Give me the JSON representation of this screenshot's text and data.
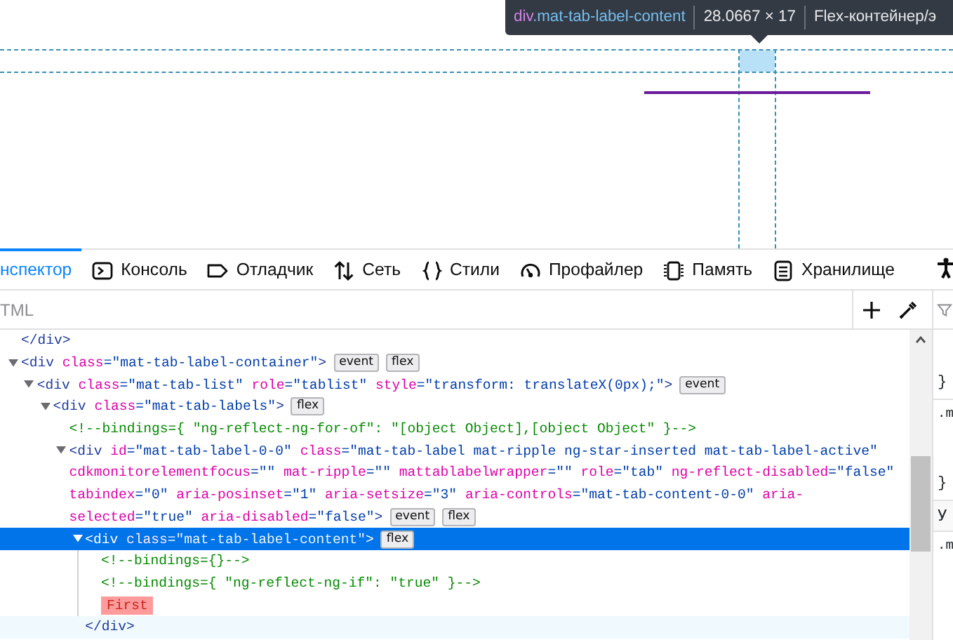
{
  "page_overlay": {
    "tooltip": {
      "tag": "div",
      "classes": ".mat-tab-label-content",
      "size": "28.0667 × 17",
      "type": "Flex-контейнер/э"
    }
  },
  "toolbar": {
    "tabs": [
      {
        "label": "нспектор",
        "selected": true
      },
      {
        "label": "Консоль",
        "selected": false
      },
      {
        "label": "Отладчик",
        "selected": false
      },
      {
        "label": "Сеть",
        "selected": false
      },
      {
        "label": "Стили",
        "selected": false
      },
      {
        "label": "Профайлер",
        "selected": false
      },
      {
        "label": "Память",
        "selected": false
      },
      {
        "label": "Хранилище",
        "selected": false
      }
    ]
  },
  "search": {
    "placeholder": "TML"
  },
  "markup_tree": [
    {
      "lines": [
        [
          {
            "kind": "tag",
            "text": "</div>"
          }
        ]
      ]
    },
    {
      "expanded": true,
      "badges": [
        "event",
        "flex"
      ],
      "lines": [
        [
          {
            "kind": "tag",
            "text": "<div"
          },
          {
            "kind": "attr",
            "text": " class"
          },
          {
            "kind": "value",
            "text": "=\"mat-tab-label-container\""
          },
          {
            "kind": "tag",
            "text": ">"
          }
        ]
      ],
      "children": [
        {
          "expanded": true,
          "badges": [
            "event"
          ],
          "lines": [
            [
              {
                "kind": "tag",
                "text": "<div"
              },
              {
                "kind": "attr",
                "text": " class"
              },
              {
                "kind": "value",
                "text": "=\"mat-tab-list\""
              },
              {
                "kind": "attr",
                "text": " role"
              },
              {
                "kind": "value",
                "text": "=\"tablist\""
              },
              {
                "kind": "attr",
                "text": " style"
              },
              {
                "kind": "value",
                "text": "=\"transform: translateX(0px);\""
              },
              {
                "kind": "tag",
                "text": ">"
              }
            ]
          ],
          "children": [
            {
              "expanded": true,
              "badges": [
                "flex"
              ],
              "lines": [
                [
                  {
                    "kind": "tag",
                    "text": "<div"
                  },
                  {
                    "kind": "attr",
                    "text": " class"
                  },
                  {
                    "kind": "value",
                    "text": "=\"mat-tab-labels\""
                  },
                  {
                    "kind": "tag",
                    "text": ">"
                  }
                ]
              ],
              "children": [
                {
                  "lines": [
                    [
                      {
                        "kind": "comment",
                        "text": "<!--bindings={ \"ng-reflect-ng-for-of\": \"[object Object],[object Object\" }-->"
                      }
                    ]
                  ]
                },
                {
                  "expanded": true,
                  "badges": [
                    "event",
                    "flex"
                  ],
                  "lines": [
                    [
                      {
                        "kind": "tag",
                        "text": "<div"
                      },
                      {
                        "kind": "attr",
                        "text": " id"
                      },
                      {
                        "kind": "value",
                        "text": "=\"mat-tab-label-0-0\""
                      },
                      {
                        "kind": "attr",
                        "text": " class"
                      },
                      {
                        "kind": "value",
                        "text": "=\"mat-tab-label mat-ripple ng-star-inserted mat-tab-label-active\""
                      }
                    ],
                    [
                      {
                        "kind": "attr",
                        "text": "cdkmonitorelementfocus"
                      },
                      {
                        "kind": "value",
                        "text": "=\"\""
                      },
                      {
                        "kind": "attr",
                        "text": " mat-ripple"
                      },
                      {
                        "kind": "value",
                        "text": "=\"\""
                      },
                      {
                        "kind": "attr",
                        "text": " mattablabelwrapper"
                      },
                      {
                        "kind": "value",
                        "text": "=\"\""
                      },
                      {
                        "kind": "attr",
                        "text": " role"
                      },
                      {
                        "kind": "value",
                        "text": "=\"tab\""
                      },
                      {
                        "kind": "attr",
                        "text": " ng-reflect-disabled"
                      },
                      {
                        "kind": "value",
                        "text": "=\"false\""
                      }
                    ],
                    [
                      {
                        "kind": "attr",
                        "text": "tabindex"
                      },
                      {
                        "kind": "value",
                        "text": "=\"0\""
                      },
                      {
                        "kind": "attr",
                        "text": " aria-posinset"
                      },
                      {
                        "kind": "value",
                        "text": "=\"1\""
                      },
                      {
                        "kind": "attr",
                        "text": " aria-setsize"
                      },
                      {
                        "kind": "value",
                        "text": "=\"3\""
                      },
                      {
                        "kind": "attr",
                        "text": " aria-controls"
                      },
                      {
                        "kind": "value",
                        "text": "=\"mat-tab-content-0-0\""
                      },
                      {
                        "kind": "attr",
                        "text": " aria-"
                      }
                    ],
                    [
                      {
                        "kind": "attr",
                        "text": "selected"
                      },
                      {
                        "kind": "value",
                        "text": "=\"true\""
                      },
                      {
                        "kind": "attr",
                        "text": " aria-disabled"
                      },
                      {
                        "kind": "value",
                        "text": "=\"false\""
                      },
                      {
                        "kind": "tag",
                        "text": ">"
                      }
                    ]
                  ],
                  "children": [
                    {
                      "expanded": true,
                      "selected": true,
                      "badges": [
                        "flex"
                      ],
                      "lines": [
                        [
                          {
                            "kind": "tag",
                            "text": "<div"
                          },
                          {
                            "kind": "attr",
                            "text": " class"
                          },
                          {
                            "kind": "value",
                            "text": "=\"mat-tab-label-content\""
                          },
                          {
                            "kind": "tag",
                            "text": ">"
                          }
                        ]
                      ],
                      "children": [
                        {
                          "lines": [
                            [
                              {
                                "kind": "comment",
                                "text": "<!--bindings={}-->"
                              }
                            ]
                          ]
                        },
                        {
                          "lines": [
                            [
                              {
                                "kind": "comment",
                                "text": "<!--bindings={ \"ng-reflect-ng-if\": \"true\" }-->"
                              }
                            ]
                          ]
                        },
                        {
                          "lines": [
                            [
                              {
                                "kind": "text",
                                "text": "First",
                                "highlighted": true
                              }
                            ]
                          ]
                        }
                      ],
                      "close": [
                        {
                          "kind": "tag",
                          "text": "</div>"
                        }
                      ]
                    }
                  ]
                }
              ]
            }
          ]
        }
      ]
    }
  ],
  "side_panel": [
    {
      "kind": "brace",
      "text": "}"
    },
    {
      "kind": "selector",
      "text": ".m"
    },
    {
      "kind": "brace",
      "text": "}"
    },
    {
      "kind": "header",
      "text": "У"
    },
    {
      "kind": "selector",
      "text": ".m"
    }
  ]
}
